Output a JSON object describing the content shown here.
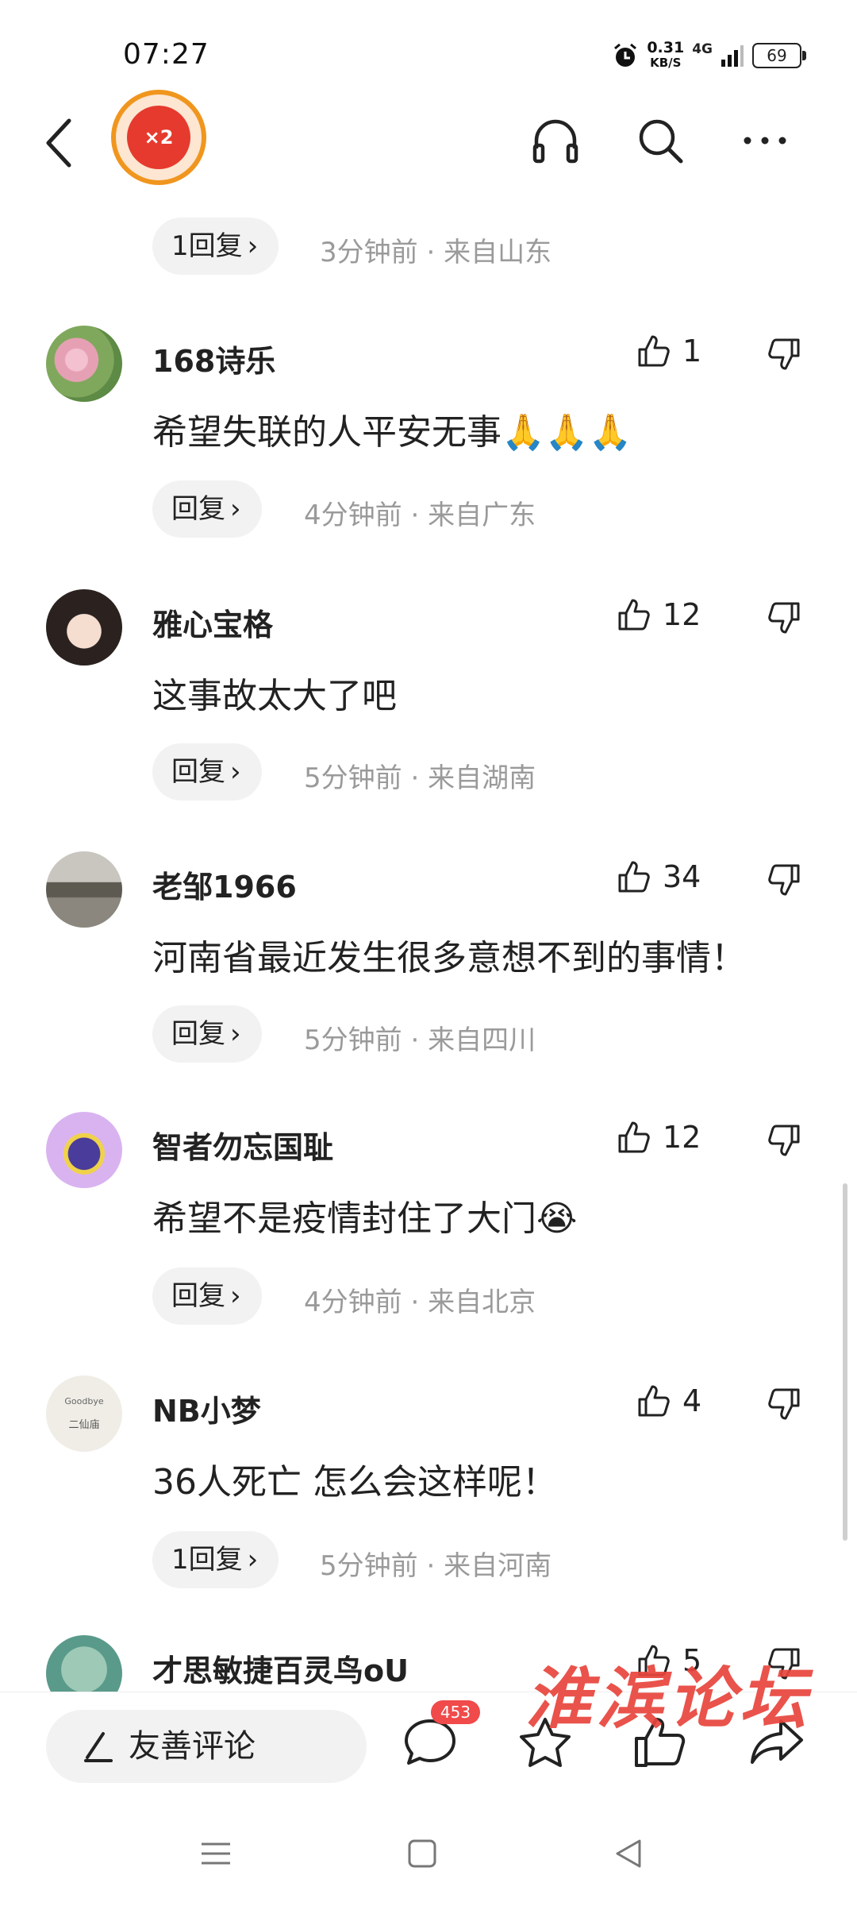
{
  "status_bar": {
    "time": "07:27",
    "net_speed_value": "0.31",
    "net_speed_unit": "KB/S",
    "network": "4G",
    "battery": "69"
  },
  "top_bar": {
    "red_packet_label": "×2",
    "icons": [
      "back-icon",
      "headphones-icon",
      "search-icon",
      "more-icon"
    ]
  },
  "comments": [
    {
      "username": "",
      "likes": "",
      "text": "",
      "reply_label": "1回复",
      "time": "3分钟前",
      "location": "来自山东"
    },
    {
      "username": "168诗乐",
      "likes": "1",
      "text": "希望失联的人平安无事🙏🙏🙏",
      "reply_label": "回复",
      "time": "4分钟前",
      "location": "来自广东"
    },
    {
      "username": "雅心宝格",
      "likes": "12",
      "text": "这事故太大了吧",
      "reply_label": "回复",
      "time": "5分钟前",
      "location": "来自湖南"
    },
    {
      "username": "老邹1966",
      "likes": "34",
      "text": "河南省最近发生很多意想不到的事情！",
      "reply_label": "回复",
      "time": "5分钟前",
      "location": "来自四川"
    },
    {
      "username": "智者勿忘国耻",
      "likes": "12",
      "text": "希望不是疫情封住了大门😭",
      "reply_label": "回复",
      "time": "4分钟前",
      "location": "来自北京"
    },
    {
      "username": "NB小梦",
      "likes": "4",
      "text": "36人死亡 怎么会这样呢！",
      "reply_label": "1回复",
      "time": "5分钟前",
      "location": "来自河南",
      "avatar_text_1": "Goodbye",
      "avatar_text_2": "二仙庙"
    },
    {
      "username": "才思敏捷百灵鸟oU",
      "likes": "5"
    }
  ],
  "bottom_bar": {
    "comment_placeholder": "友善评论",
    "comment_count_badge": "453"
  },
  "watermark": "淮滨论坛",
  "colors": {
    "accent_red": "#f04a4a",
    "ring_orange": "#f0961e",
    "meta_gray": "#9a9a9a",
    "pill_bg": "#f2f2f2"
  }
}
